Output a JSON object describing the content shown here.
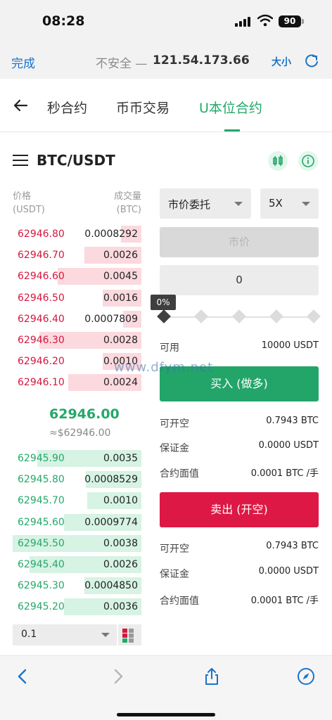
{
  "status": {
    "time": "08:28",
    "battery": "90"
  },
  "browser": {
    "done_label": "完成",
    "insecure_label": "不安全 —",
    "host": "121.54.173.66",
    "text_size_label": "大小"
  },
  "nav": {
    "tabs": [
      {
        "label": "秒合约",
        "active": false
      },
      {
        "label": "币币交易",
        "active": false
      },
      {
        "label": "U本位合约",
        "active": true
      }
    ]
  },
  "header": {
    "pair": "BTC/USDT"
  },
  "order_book": {
    "price_header": "价格",
    "price_unit": "(USDT)",
    "volume_header": "成交量",
    "volume_unit": "(BTC)",
    "asks": [
      {
        "price": "62946.80",
        "qty": "0.0008292",
        "depth": 0.16
      },
      {
        "price": "62946.70",
        "qty": "0.0026",
        "depth": 0.44
      },
      {
        "price": "62946.60",
        "qty": "0.0045",
        "depth": 0.65
      },
      {
        "price": "62946.50",
        "qty": "0.0016",
        "depth": 0.3
      },
      {
        "price": "62946.40",
        "qty": "0.0007809",
        "depth": 0.14
      },
      {
        "price": "62946.30",
        "qty": "0.0028",
        "depth": 0.79
      },
      {
        "price": "62946.20",
        "qty": "0.0010",
        "depth": 0.3
      },
      {
        "price": "62946.10",
        "qty": "0.0024",
        "depth": 0.57
      }
    ],
    "last_price": "62946.00",
    "last_price_usd": "≈$62946.00",
    "bids": [
      {
        "price": "62945.90",
        "qty": "0.0035",
        "depth": 0.81
      },
      {
        "price": "62945.80",
        "qty": "0.0008529",
        "depth": 0.43
      },
      {
        "price": "62945.70",
        "qty": "0.0010",
        "depth": 0.42
      },
      {
        "price": "62945.60",
        "qty": "0.0009774",
        "depth": 0.6
      },
      {
        "price": "62945.50",
        "qty": "0.0038",
        "depth": 1.0
      },
      {
        "price": "62945.40",
        "qty": "0.0026",
        "depth": 0.87
      },
      {
        "price": "62945.30",
        "qty": "0.0004850",
        "depth": 0.44
      },
      {
        "price": "62945.20",
        "qty": "0.0036",
        "depth": 0.6
      }
    ],
    "depth_value": "0.1"
  },
  "order_form": {
    "order_type": "市价委托",
    "leverage": "5X",
    "price_placeholder": "市价",
    "amount_value": "0",
    "slider_percent": "0%",
    "available_label": "可用",
    "available_value": "10000 USDT",
    "buy_label": "买入 (做多)",
    "sell_label": "卖出 (开空)",
    "buy_info": [
      {
        "label": "可开空",
        "value": "0.7943 BTC"
      },
      {
        "label": "保证金",
        "value": "0.0000 USDT"
      },
      {
        "label": "合约面值",
        "value": "0.0001 BTC /手"
      }
    ],
    "sell_info": [
      {
        "label": "可开空",
        "value": "0.7943 BTC"
      },
      {
        "label": "保证金",
        "value": "0.0000 USDT"
      },
      {
        "label": "合约面值",
        "value": "0.0001 BTC /手"
      }
    ]
  },
  "watermark": "www.dfym.net",
  "colors": {
    "green": "#24a86a",
    "red": "#d4173f",
    "link": "#1a73c8"
  },
  "icons": [
    "wifi-icon",
    "reload-icon",
    "back-arrow-icon",
    "menu-icon",
    "kline-icon",
    "info-icon",
    "share-icon",
    "compass-icon"
  ]
}
